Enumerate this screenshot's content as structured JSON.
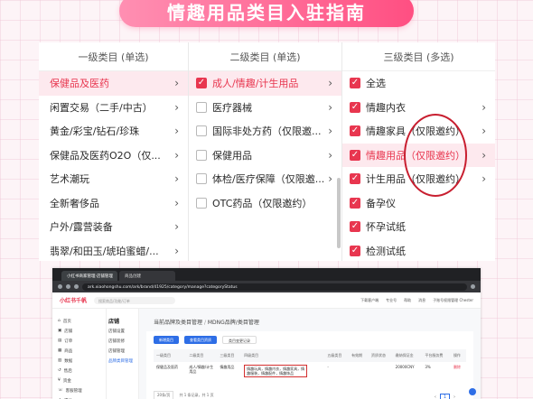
{
  "banner": {
    "title": "情趣用品类目入驻指南"
  },
  "picker": {
    "level1": {
      "header": "一级类目 (单选)",
      "items": [
        "保健品及医药",
        "闲置交易（二手/中古）",
        "黄金/彩宝/钻石/珍珠",
        "保健品及医药O2O（仅...",
        "艺术潮玩",
        "全新奢侈品",
        "户外/露营装备",
        "翡翠/和田玉/琥珀蜜蜡/..."
      ]
    },
    "level2": {
      "header": "二级类目 (单选)",
      "items": [
        "成人/情趣/计生用品",
        "医疗器械",
        "国际非处方药（仅限邀...",
        "保健用品",
        "体检/医疗保障（仅限邀...",
        "OTC药品（仅限邀约）"
      ]
    },
    "level3": {
      "header": "三级类目 (多选)",
      "items": [
        "全选",
        "情趣内衣",
        "情趣家具（仅限邀约）",
        "情趣用品（仅限邀约）",
        "计生用品（仅限邀约）",
        "备孕仪",
        "怀孕试纸",
        "检测试纸"
      ]
    }
  },
  "browser": {
    "tabs": [
      "小红书商家管理·店铺管理",
      "商品创建"
    ],
    "url": "ark.xiaohongshu.com/ark/brand/41925/category/manage?categoryStatus",
    "app_name": "小红书千帆",
    "search_placeholder": "搜索商品/功能/订单",
    "header_links": [
      "下载客户端",
      "专业号",
      "帮助",
      "消息",
      "子账号权限管理 Chester"
    ],
    "nav": {
      "home": "首页",
      "shop": "店铺",
      "shop_setting": "店铺设置",
      "order": "订单",
      "shop_decor": "店铺装修",
      "goods": "商品",
      "marketing": "店铺管理",
      "data": "数据",
      "brand_cat": "品牌类目管理",
      "after": "售后",
      "finance": "资金",
      "service": "客服管理",
      "growth": "成长"
    },
    "breadcrumb": [
      "当前品牌及类目管理",
      "MDNG品牌/类目管理"
    ],
    "buttons": [
      "新增类目",
      "查看类目资质",
      "类目变更记录"
    ],
    "table": {
      "headers": [
        "一级类目",
        "二级类目",
        "三级类目",
        "四级类目",
        "五级类目",
        "有效期",
        "资质状态",
        "缴纳保证金",
        "平台服务费",
        "操作"
      ],
      "row": [
        "保健品及医药",
        "成人/情趣/计生用品",
        "情趣用品",
        "情趣玩具，情趣内衣，情趣家具，情趣服装，情趣配件，情趣饰品",
        "-",
        "",
        "",
        "20000CNY",
        "3%",
        "删除"
      ]
    },
    "pager_size": "20条/页",
    "pager_text": "共 1 条记录，共 1 页",
    "page_current": "1"
  }
}
